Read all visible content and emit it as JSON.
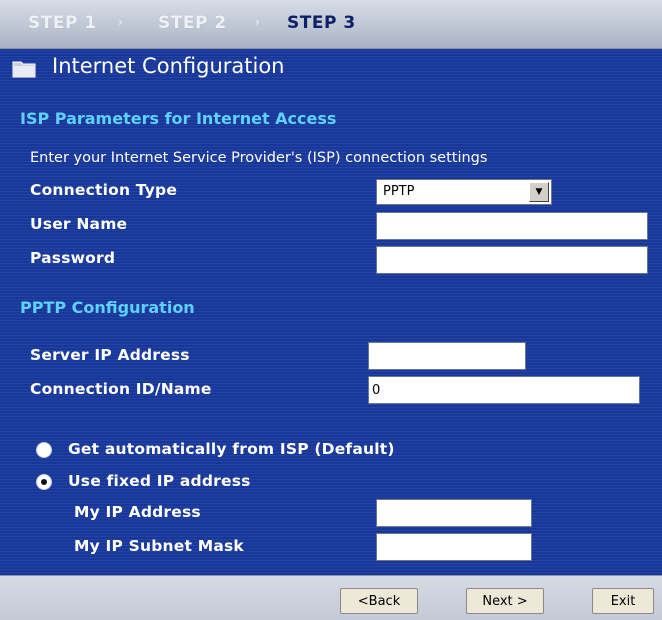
{
  "steps": [
    "STEP 1",
    "STEP 2",
    "STEP 3"
  ],
  "step_arrow": "›",
  "header": {
    "title": "Internet Configuration",
    "icon": "folder-icon"
  },
  "isp_section": {
    "title": "ISP Parameters for Internet Access",
    "description": "Enter your Internet Service Provider's (ISP) connection settings",
    "connection_type_label": "Connection Type",
    "connection_type_value": "PPTP",
    "user_name_label": "User Name",
    "user_name_value": "",
    "password_label": "Password",
    "password_value": ""
  },
  "pptp_section": {
    "title": "PPTP Configuration",
    "server_ip_label": "Server IP Address",
    "server_ip_value": "",
    "connection_id_label": "Connection ID/Name",
    "connection_id_value": "0"
  },
  "ip_options": {
    "auto_label": "Get automatically from ISP (Default)",
    "fixed_label": "Use fixed IP address",
    "selected": "fixed",
    "my_ip_label": "My IP Address",
    "my_ip_value": "",
    "subnet_label": "My IP Subnet Mask",
    "subnet_value": ""
  },
  "buttons": {
    "back": "<Back",
    "next": "Next >",
    "exit": "Exit"
  },
  "colors": {
    "background": "#17379a",
    "section_heading": "#5fd1ff",
    "active_step": "#0e1f66"
  }
}
